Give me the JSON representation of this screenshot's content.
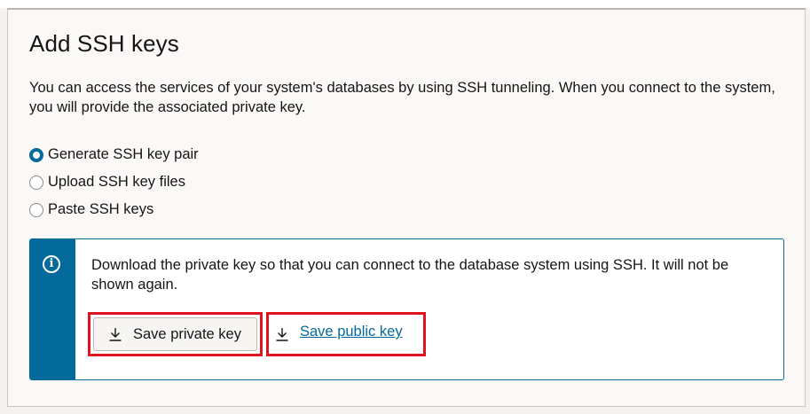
{
  "panel": {
    "title": "Add SSH keys",
    "description": "You can access the services of your system's databases by using SSH tunneling. When you connect to the system, you will provide the associated private key."
  },
  "ssh_options": [
    {
      "label": "Generate SSH key pair",
      "selected": true
    },
    {
      "label": "Upload SSH key files",
      "selected": false
    },
    {
      "label": "Paste SSH keys",
      "selected": false
    }
  ],
  "info": {
    "icon": "info-icon",
    "icon_glyph": "i",
    "message": "Download the private key so that you can connect to the database system using SSH. It will not be shown again.",
    "save_private_label": "Save private key",
    "save_public_label": "Save public key"
  },
  "colors": {
    "accent": "#04699b",
    "highlight_frame": "#e0141e",
    "background": "#fbf9f8"
  }
}
